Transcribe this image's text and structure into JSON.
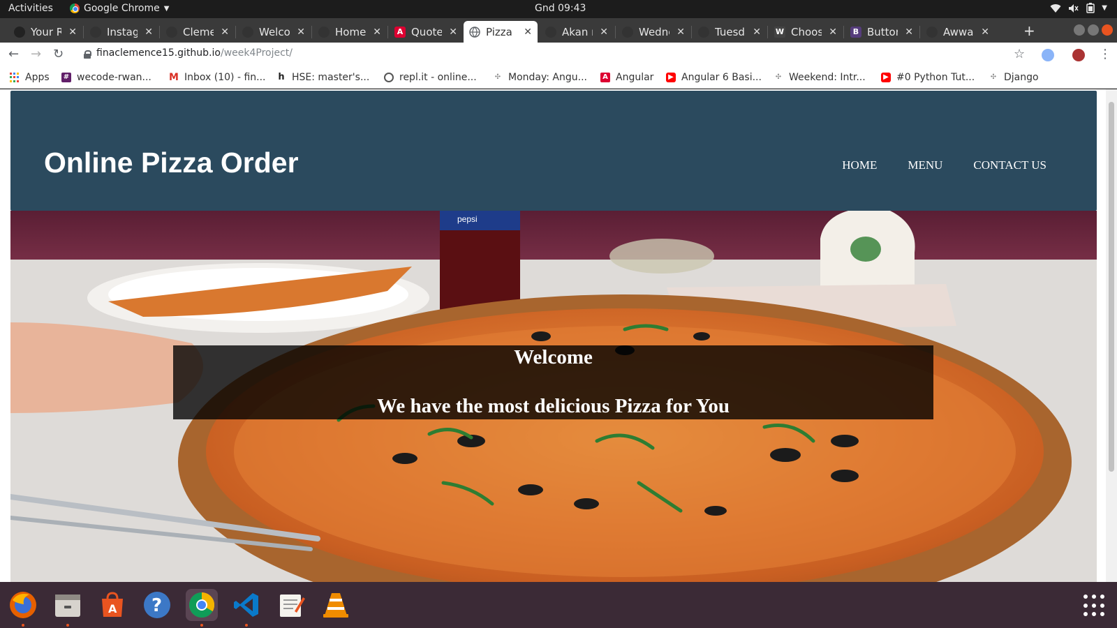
{
  "topbar": {
    "activities": "Activities",
    "app_name": "Google Chrome",
    "clock": "Gnd 09:43"
  },
  "tabs": [
    {
      "title": "Your R",
      "icon": "github-icon"
    },
    {
      "title": "Instagr",
      "icon": "instagram-icon"
    },
    {
      "title": "Clemen",
      "icon": "page-icon"
    },
    {
      "title": "Welco",
      "icon": "page-icon"
    },
    {
      "title": "Home",
      "icon": "page-icon"
    },
    {
      "title": "Quote",
      "icon": "angular-icon"
    },
    {
      "title": "Pizza",
      "icon": "globe-icon",
      "active": true
    },
    {
      "title": "Akan n",
      "icon": "page-icon"
    },
    {
      "title": "Wedne",
      "icon": "page-icon"
    },
    {
      "title": "Tuesda",
      "icon": "page-icon"
    },
    {
      "title": "Choos",
      "icon": "w-icon"
    },
    {
      "title": "Button",
      "icon": "bootstrap-icon"
    },
    {
      "title": "Awwar",
      "icon": "page-icon"
    }
  ],
  "address": {
    "host": "finaclemence15.github.io",
    "path": "/week4Project/"
  },
  "bookmarks": [
    {
      "label": "Apps",
      "icon": "apps-icon"
    },
    {
      "label": "wecode-rwan...",
      "icon": "slack-icon"
    },
    {
      "label": "Inbox (10) - fin...",
      "icon": "gmail-icon"
    },
    {
      "label": "HSE: master's...",
      "icon": "hse-icon"
    },
    {
      "label": "repl.it - online...",
      "icon": "replit-icon"
    },
    {
      "label": "Monday: Angu...",
      "icon": "moringa-icon"
    },
    {
      "label": "Angular",
      "icon": "angular-icon"
    },
    {
      "label": "Angular 6 Basi...",
      "icon": "youtube-icon"
    },
    {
      "label": "Weekend: Intr...",
      "icon": "moringa-icon"
    },
    {
      "label": "#0 Python Tut...",
      "icon": "youtube-icon"
    },
    {
      "label": "Django",
      "icon": "moringa-icon"
    }
  ],
  "site": {
    "title": "Online Pizza Order",
    "nav": [
      "HOME",
      "MENU",
      "CONTACT US"
    ],
    "hero": {
      "welcome": "Welcome",
      "tagline": "We have the most delicious Pizza for You",
      "bottle_label": "pepsi"
    }
  },
  "dock": [
    "firefox-icon",
    "files-icon",
    "software-center-icon",
    "help-icon",
    "chrome-icon",
    "vscode-icon",
    "text-editor-icon",
    "vlc-icon"
  ],
  "colors": {
    "header_bg": "#2b4a5e",
    "tab_bar": "#3a3a3a",
    "dock_bg": "#3b2a36",
    "ubuntu_orange": "#e95420"
  }
}
